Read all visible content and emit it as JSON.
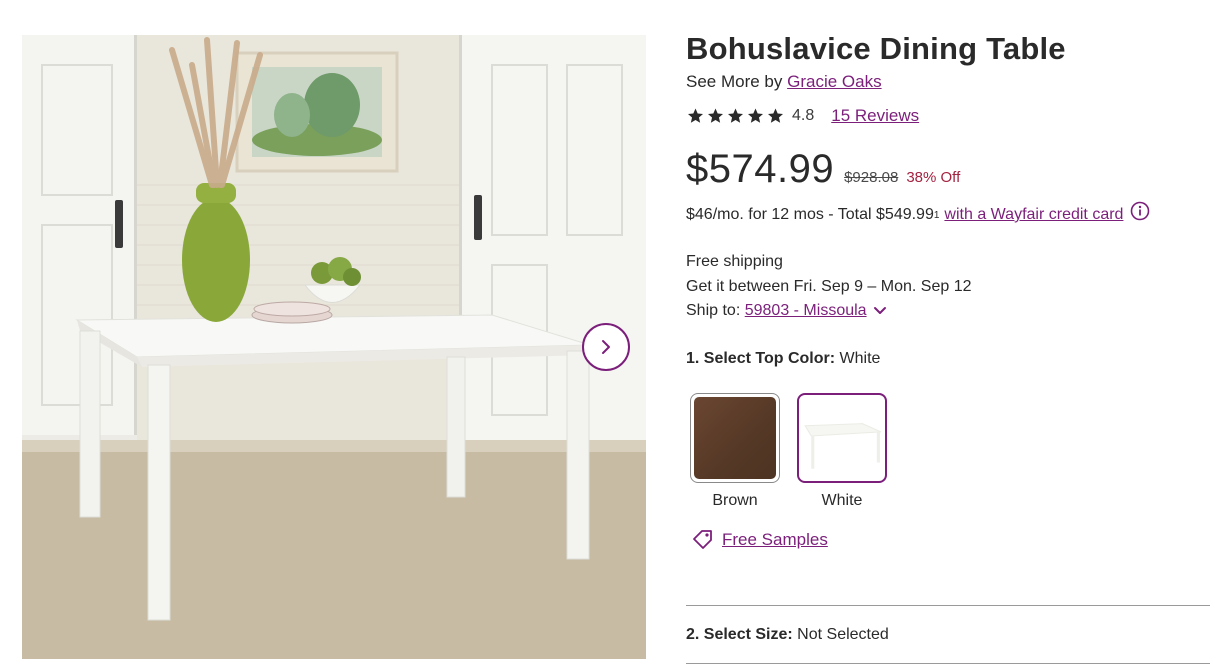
{
  "product": {
    "title": "Bohuslavice Dining Table",
    "see_more_prefix": "See More by",
    "brand": "Gracie Oaks",
    "rating": "4.8",
    "stars": 5,
    "reviews_link": "15 Reviews"
  },
  "pricing": {
    "price": "$574.99",
    "was_price": "$928.08",
    "discount": "38% Off",
    "finance_text": "$46/mo. for 12 mos - Total $549.99",
    "finance_footnote": "1",
    "finance_link": "with a Wayfair credit card"
  },
  "shipping": {
    "free_shipping": "Free shipping",
    "delivery_window": "Get it between Fri. Sep 9 – Mon. Sep 12",
    "ship_to_label": "Ship to:",
    "ship_to_value": "59803 - Missoula"
  },
  "options": {
    "color_label": "1. Select Top Color:",
    "color_value": "White",
    "swatches": [
      {
        "label": "Brown",
        "color": "#5b3d2b",
        "selected": false
      },
      {
        "label": "White",
        "color": "#ffffff",
        "selected": true
      }
    ],
    "free_samples": "Free Samples",
    "size_label": "2. Select Size:",
    "size_value": "Not Selected"
  },
  "colors": {
    "accent": "#7b1f7b",
    "discount": "#a32240",
    "text": "#2a2a2a"
  },
  "icons": {
    "next": "chevron-right-icon",
    "star": "star-icon",
    "info": "info-icon",
    "dropdown": "chevron-down-icon",
    "samples": "tag-icon"
  }
}
